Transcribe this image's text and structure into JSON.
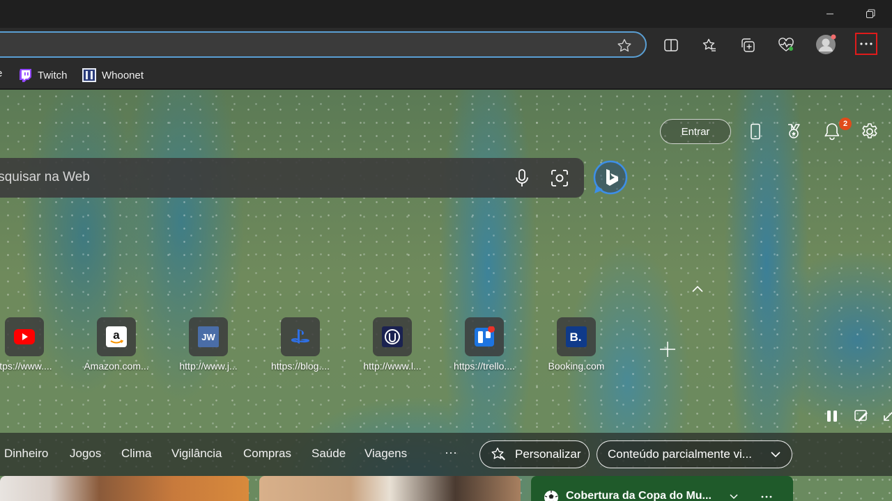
{
  "favorites": [
    {
      "label": "Twitch",
      "icon": "twitch-icon"
    },
    {
      "label": "Whoonet",
      "icon": "whoonet-icon"
    }
  ],
  "header": {
    "signin_label": "Entrar",
    "notification_count": "2"
  },
  "search": {
    "placeholder": "Pesquisar na Web",
    "visible_text": "uisar na Web"
  },
  "top_sites": [
    {
      "label": "ttps://www....",
      "icon": "youtube-icon"
    },
    {
      "label": "Amazon.com...",
      "icon": "amazon-icon"
    },
    {
      "label": "http://www.j...",
      "icon": "jw-icon"
    },
    {
      "label": "https://blog....",
      "icon": "playstation-icon"
    },
    {
      "label": "http://www.l...",
      "icon": "unreal-icon"
    },
    {
      "label": "https://trello....",
      "icon": "trello-icon"
    },
    {
      "label": "Booking.com",
      "icon": "booking-icon"
    }
  ],
  "nav": {
    "items": [
      "Dinheiro",
      "Jogos",
      "Clima",
      "Vigilância",
      "Compras",
      "Saúde",
      "Viagens"
    ],
    "more": "···",
    "personalize_label": "Personalizar",
    "content_label": "Conteúdo parcialmente vi..."
  },
  "cards": {
    "news_title": "Cobertura da Copa do Mu..."
  },
  "colors": {
    "address_border": "#5a9fd4",
    "more_highlight": "#e01b1b",
    "badge": "#e04b1a",
    "bing_blue": "#2b7de9"
  }
}
